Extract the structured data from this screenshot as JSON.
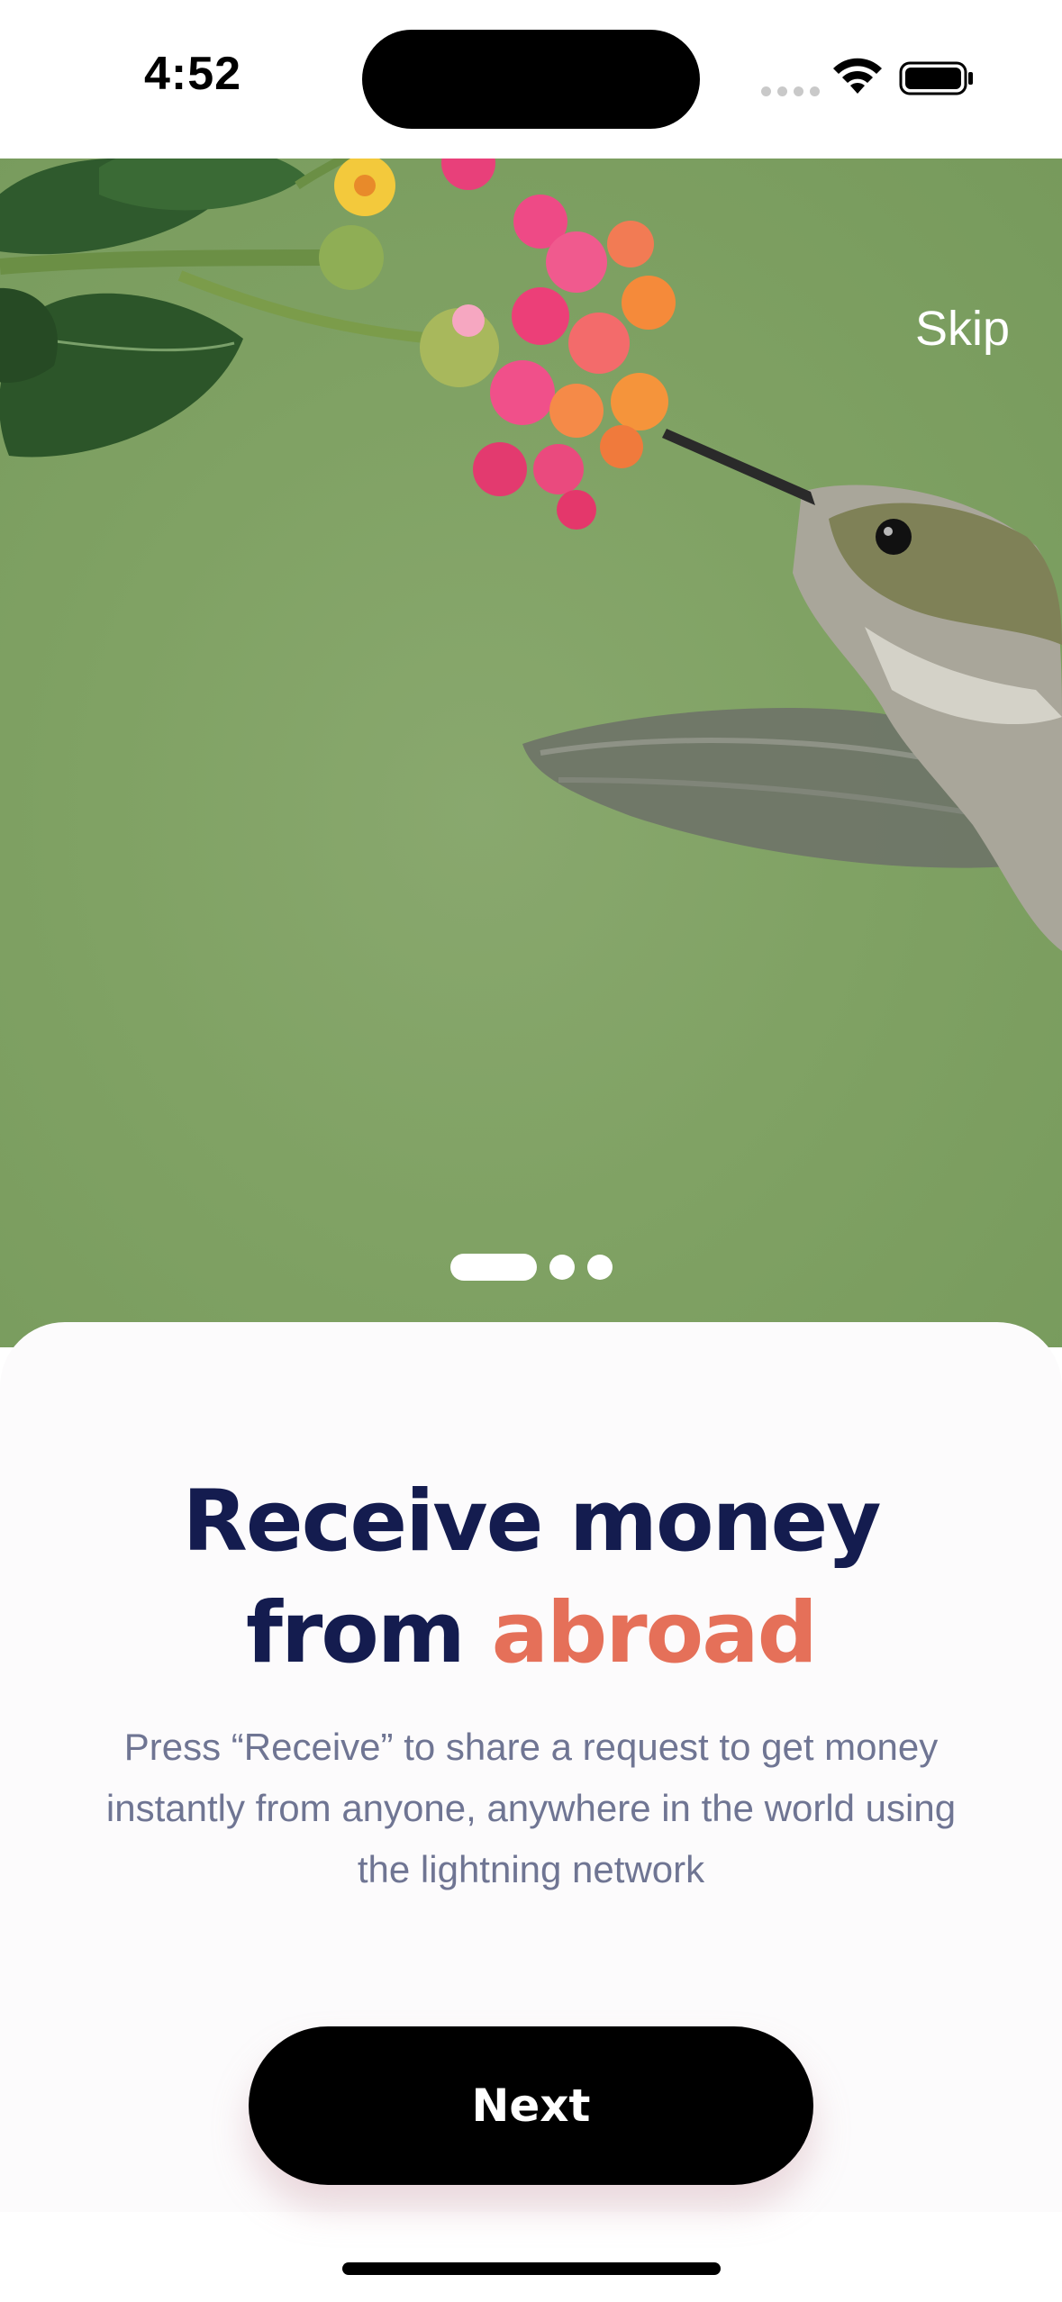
{
  "status_bar": {
    "time": "4:52",
    "icons": [
      "cellular-dots-icon",
      "wifi-icon",
      "battery-icon"
    ]
  },
  "hero": {
    "image": "hummingbird-feeding-on-lantana-flowers",
    "skip_label": "Skip"
  },
  "pager": {
    "total": 3,
    "active_index": 0
  },
  "content": {
    "headline_part1": "Receive money",
    "headline_part2": "from",
    "headline_accent": "abroad",
    "description": "Press “Receive” to share a request to get money instantly from anyone, anywhere in the world using the lightning network"
  },
  "actions": {
    "next_label": "Next"
  },
  "colors": {
    "headline": "#141c4f",
    "accent": "#e57059",
    "description": "#6f7593",
    "hero_background": "#80a264",
    "button": "#000000"
  }
}
